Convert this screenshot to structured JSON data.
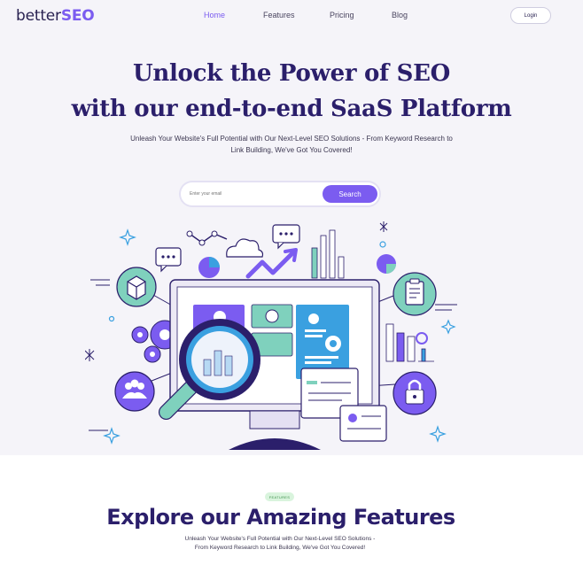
{
  "nav": {
    "logo_text": "better",
    "logo_accent": "SEO",
    "links": [
      "Home",
      "Features",
      "Pricing",
      "Blog"
    ],
    "login_label": "Login"
  },
  "hero": {
    "title_line1": "Unlock the Power of SEO",
    "title_line2": "with our end-to-end SaaS Platform",
    "subtitle": "Unleash Your Website's Full Potential with Our Next-Level SEO Solutions - From Keyword Research to Link Building, We've Got You Covered!",
    "search_placeholder": "Enter your email",
    "search_button": "Search"
  },
  "features": {
    "badge": "FEATURES",
    "title": "Explore our Amazing Features",
    "subtitle": "Unleash Your Website's Full Potential with Our Next-Level SEO Solutions - From Keyword Research to Link Building, We've Got You Covered!"
  },
  "colors": {
    "brand": "#7b5cf0",
    "navy": "#2b1f6b",
    "mint": "#7fd1bd",
    "hero_bg": "#f5f4f9",
    "badge_bg": "#d9f4dd"
  },
  "icons": [
    "box-icon",
    "gears-icon",
    "users-icon",
    "clipboard-icon",
    "lock-icon",
    "magnifier-icon",
    "chat-bubble-icon",
    "cloud-icon",
    "pie-chart-icon",
    "bar-chart-icon",
    "arrow-up-icon",
    "sparkle-icon"
  ]
}
